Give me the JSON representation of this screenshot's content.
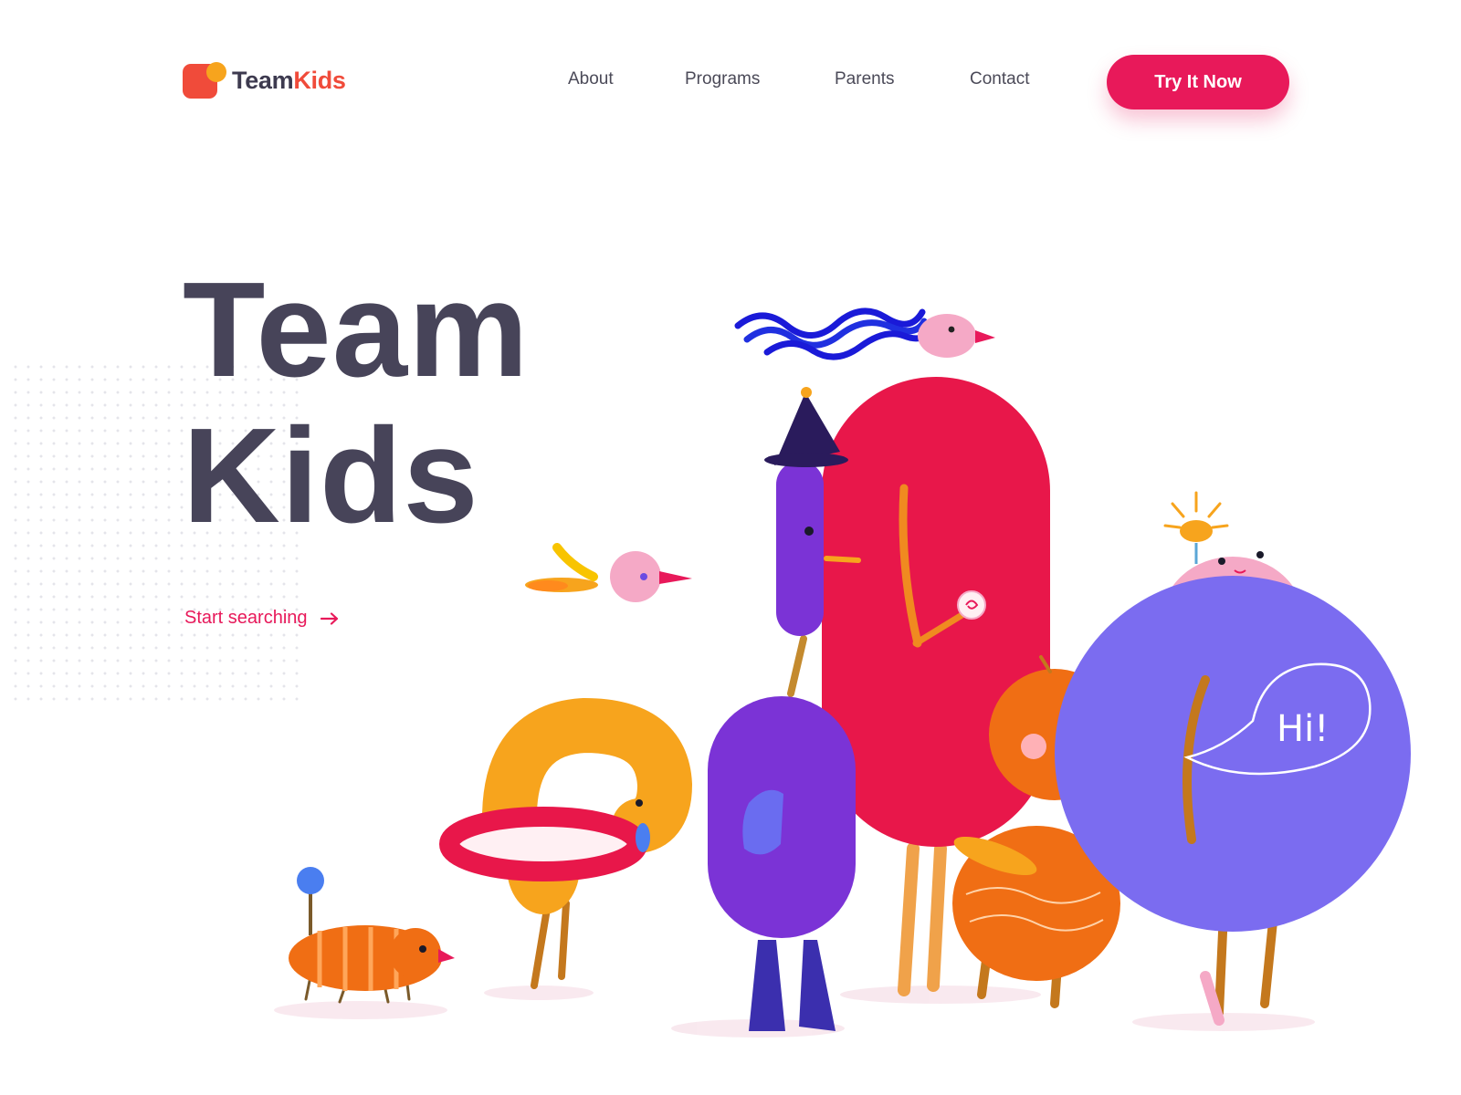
{
  "brand": {
    "name_part1": "Team",
    "name_part2": "Kids",
    "primary_color": "#e8195a",
    "accent_color": "#f04b3a",
    "text_color": "#474459"
  },
  "nav": {
    "links": [
      "About",
      "Programs",
      "Parents",
      "Contact"
    ],
    "cta_label": "Try It Now"
  },
  "hero": {
    "title_line1": "Team",
    "title_line2": "Kids",
    "link_label": "Start searching",
    "link_icon": "arrow-right-icon"
  },
  "illustration": {
    "speech_bubble_text": "Hi!"
  }
}
